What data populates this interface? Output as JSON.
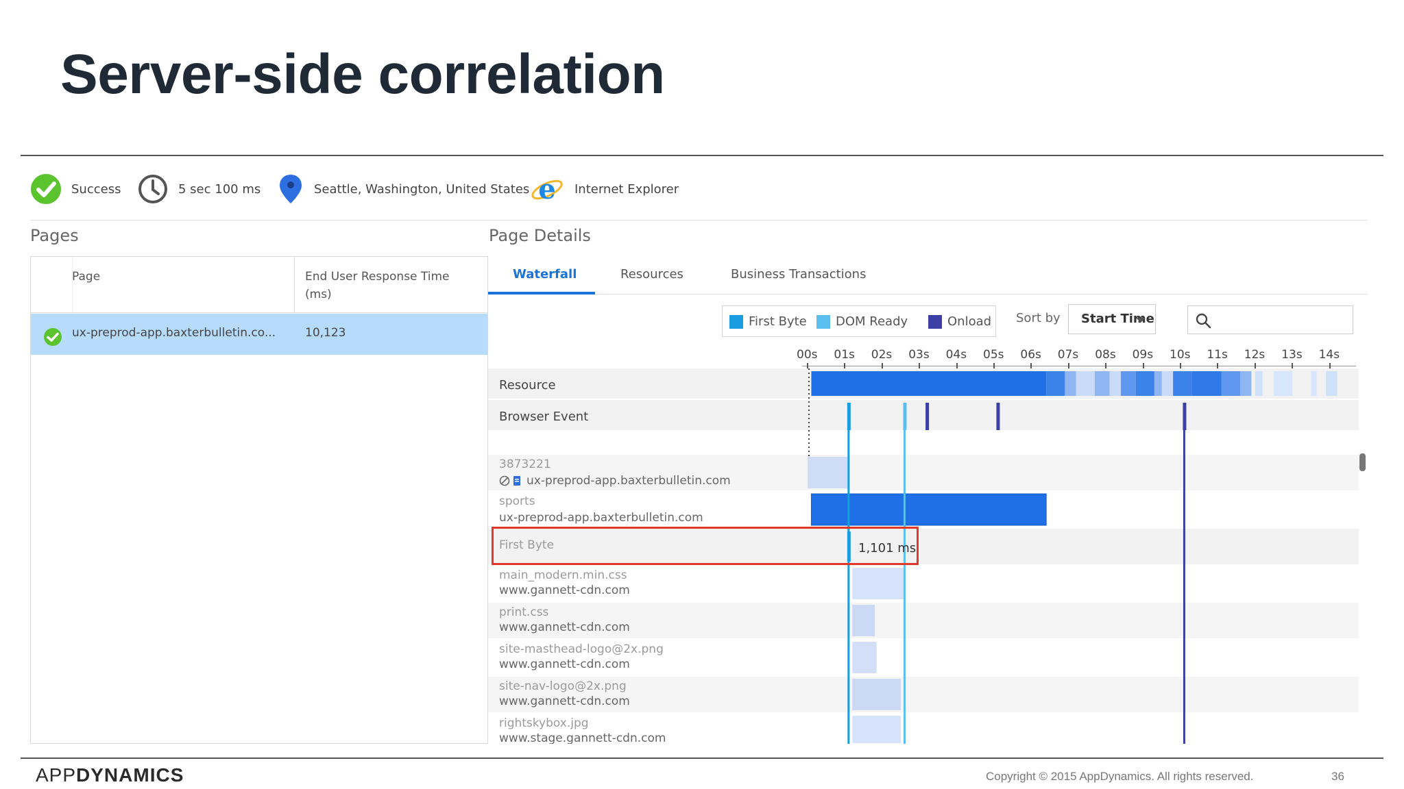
{
  "slide": {
    "title": "Server-side correlation",
    "logo_prefix": "APP",
    "logo_suffix": "DYNAMICS",
    "copyright": "Copyright © 2015 AppDynamics. All rights reserved.",
    "page_number": "36"
  },
  "status": {
    "result": "Success",
    "duration": "5 sec 100 ms",
    "location": "Seattle, Washington, United States",
    "browser": "Internet Explorer",
    "icons": [
      "success-check-icon",
      "clock-icon",
      "location-pin-icon",
      "internet-explorer-icon"
    ]
  },
  "pages": {
    "section_label": "Pages",
    "columns": [
      "Page",
      "End User Response Time (ms)"
    ],
    "rows": [
      {
        "page": "ux-preprod-app.baxterbulletin.co...",
        "response_time": "10,123"
      }
    ]
  },
  "details": {
    "section_label": "Page Details",
    "tabs": [
      "Waterfall",
      "Resources",
      "Business Transactions"
    ],
    "active_tab": "Waterfall",
    "legend": [
      {
        "label": "First Byte",
        "color": "#1a9de0"
      },
      {
        "label": "DOM Ready",
        "color": "#5bc0f0"
      },
      {
        "label": "Onload",
        "color": "#3b3fa6"
      }
    ],
    "sort_by_label": "Sort by",
    "sort_by_value": "Start Time",
    "axis_ticks": [
      "00s",
      "01s",
      "02s",
      "03s",
      "04s",
      "05s",
      "06s",
      "07s",
      "08s",
      "09s",
      "10s",
      "11s",
      "12s",
      "13s",
      "14s"
    ],
    "summary_rows": [
      "Resource",
      "Browser Event"
    ],
    "resources": [
      {
        "name": "3873221",
        "host": "ux-preprod-app.baxterbulletin.com",
        "start_s": 0.0,
        "end_s": 1.1,
        "color": "#cfdcf6"
      },
      {
        "name": "sports",
        "host": "ux-preprod-app.baxterbulletin.com",
        "start_s": 0.1,
        "end_s": 6.4,
        "color": "#1f6fe6"
      },
      {
        "name": "First Byte",
        "host": "",
        "start_s": 1.1,
        "end_s": 1.1,
        "color": "#1a9de0"
      },
      {
        "name": "main_modern.min.css",
        "host": "www.gannett-cdn.com",
        "start_s": 1.2,
        "end_s": 2.6,
        "color": "#d6e2fa"
      },
      {
        "name": "print.css",
        "host": "www.gannett-cdn.com",
        "start_s": 1.2,
        "end_s": 1.8,
        "color": "#cbd8f6"
      },
      {
        "name": "site-masthead-logo@2x.png",
        "host": "www.gannett-cdn.com",
        "start_s": 1.2,
        "end_s": 1.85,
        "color": "#d3def8"
      },
      {
        "name": "site-nav-logo@2x.png",
        "host": "www.gannett-cdn.com",
        "start_s": 1.2,
        "end_s": 2.5,
        "color": "#cbd8f6"
      },
      {
        "name": "rightskybox.jpg",
        "host": "www.stage.gannett-cdn.com",
        "start_s": 1.2,
        "end_s": 2.5,
        "color": "#d6e2fa"
      }
    ],
    "first_byte_value": "1,101 ms",
    "markers": {
      "first_byte_s": 1.1,
      "dom_ready_s": 2.6,
      "onload_s": 10.1,
      "browser_events_s": [
        1.1,
        2.6,
        3.2,
        5.1,
        10.1
      ]
    }
  }
}
